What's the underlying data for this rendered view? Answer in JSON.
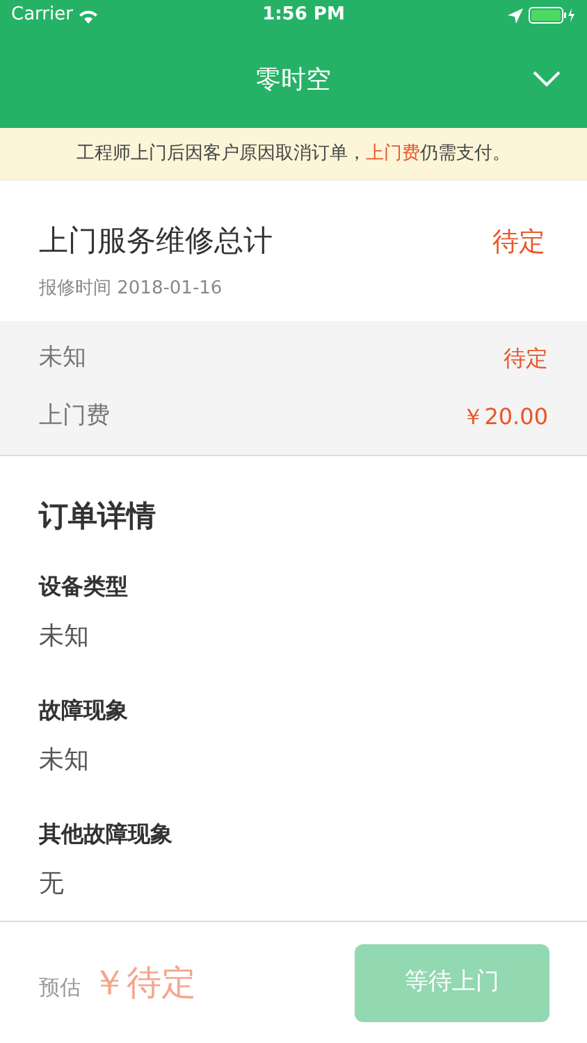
{
  "status_bar": {
    "carrier": "Carrier",
    "time": "1:56 PM"
  },
  "header": {
    "title": "零时空"
  },
  "notice": {
    "text": "工程师上门后因客户原因取消订单，**上门费**仍需支付。"
  },
  "summary": {
    "title": "上门服务维修总计",
    "status": "待定",
    "date": "报修时间 2018-01-16"
  },
  "fees": [
    {
      "label": "未知",
      "value": "待定"
    },
    {
      "label": "上门费",
      "value": "￥20.00"
    }
  ],
  "details": {
    "title": "订单详情",
    "fields": [
      {
        "label": "设备类型",
        "value": "未知"
      },
      {
        "label": "故障现象",
        "value": "未知"
      },
      {
        "label": "其他故障现象",
        "value": "无"
      }
    ]
  },
  "footer": {
    "estimate_label": "预估",
    "estimate_value": "￥待定",
    "button": {
      "label": "等待上门",
      "disabled": true
    }
  }
}
